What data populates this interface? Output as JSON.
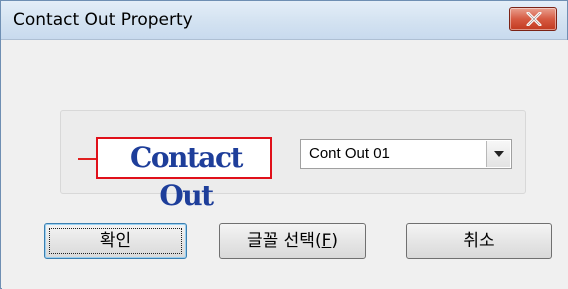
{
  "window": {
    "title": "Contact Out Property"
  },
  "preview": {
    "text": "Contact Out"
  },
  "combo": {
    "value": "Cont Out 01"
  },
  "buttons": {
    "ok": "확인",
    "font_prefix": "글꼴 선택(",
    "font_mnemonic": "F",
    "font_suffix": ")",
    "cancel": "취소"
  },
  "colors": {
    "preview_border": "#e0101a",
    "preview_text": "#1e3e9a",
    "close_button": "#c2391f"
  }
}
